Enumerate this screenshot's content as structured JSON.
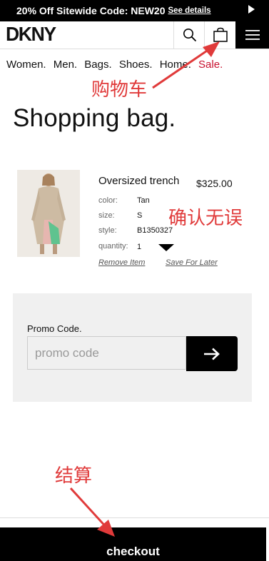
{
  "promo_bar": {
    "text": "20% Off Sitewide Code: NEW20",
    "link": "See details"
  },
  "header": {
    "logo": "DKNY"
  },
  "nav": {
    "items": [
      "Women.",
      "Men.",
      "Bags.",
      "Shoes.",
      "Home."
    ],
    "sale": "Sale."
  },
  "page_title": "Shopping bag.",
  "item": {
    "name": "Oversized trench",
    "price": "$325.00",
    "attributes": [
      {
        "label": "color:",
        "value": "Tan"
      },
      {
        "label": "size:",
        "value": "S"
      },
      {
        "label": "style:",
        "value": "B1350327"
      },
      {
        "label": "quantity:",
        "value": "1"
      }
    ],
    "remove_label": "Remove Item",
    "save_label": "Save For Later"
  },
  "promo_code": {
    "label": "Promo Code.",
    "placeholder": "promo code"
  },
  "checkout_label": "checkout",
  "annotations": {
    "cart": "购物车",
    "confirm": "确认无误",
    "checkout": "结算"
  },
  "colors": {
    "sale": "#c8102e",
    "annotation": "#e03a3a",
    "promo_bg": "#f0f0f0"
  }
}
